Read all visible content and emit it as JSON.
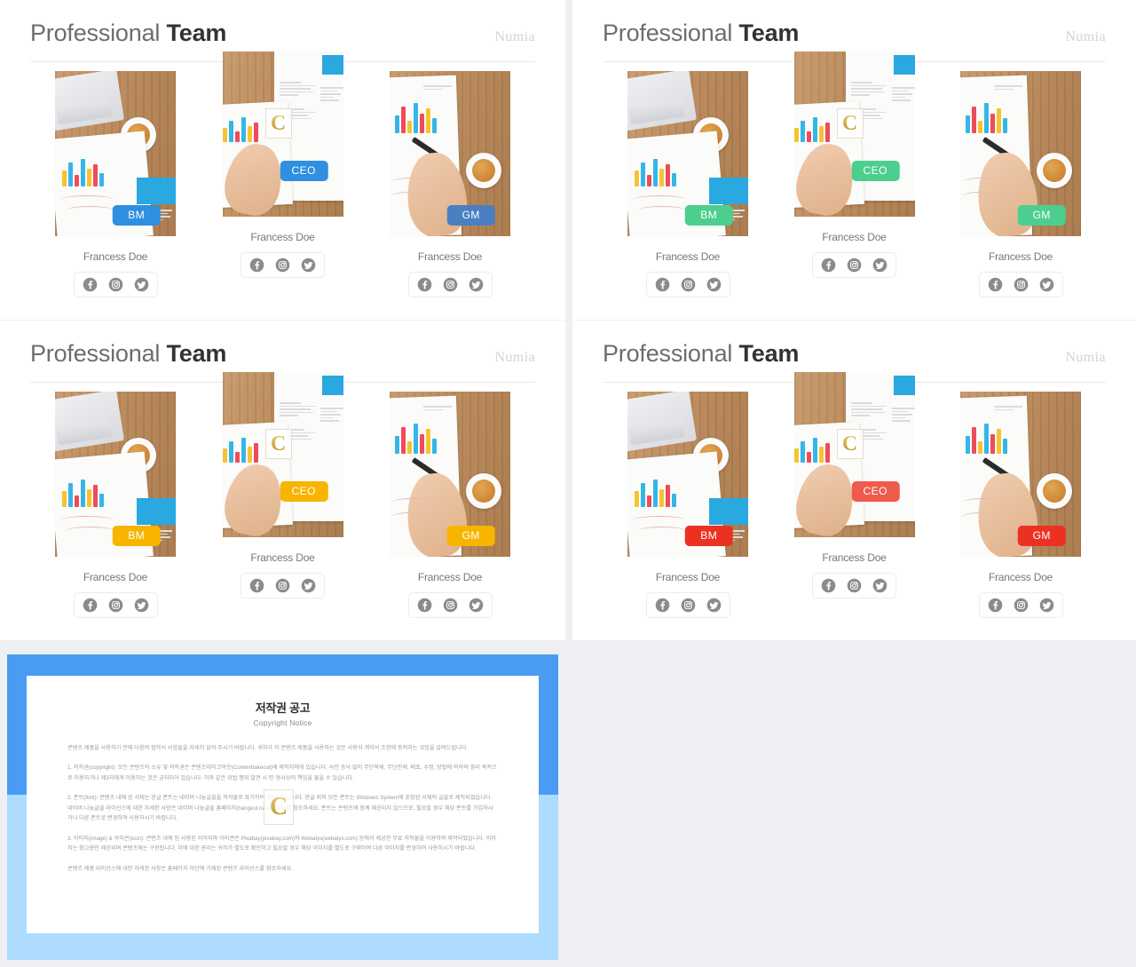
{
  "theme": {
    "page_background": "#eef0f3",
    "panel_background": "#ffffff",
    "title_color": "#333333",
    "brand_color": "#d2d2d2",
    "frame_blue_top": "#4a9cf2",
    "frame_blue_bottom": "#addcff",
    "watermark_gold": "#c9a227"
  },
  "watermark": {
    "letter": "C"
  },
  "panels": [
    {
      "id": "panel-blue",
      "title_light": "Professional",
      "title_bold": "Team",
      "brand": "Numia",
      "accent": "#2f8fe0",
      "cards": [
        {
          "badge": "BM",
          "name": "Francess Doe",
          "photo": "desk-laptop-coffee-chart"
        },
        {
          "badge": "CEO",
          "name": "Francess Doe",
          "photo": "hand-pointing-resume"
        },
        {
          "badge": "GM",
          "name": "Francess Doe",
          "photo": "hand-pen-chart-coffee"
        }
      ]
    },
    {
      "id": "panel-green",
      "title_light": "Professional",
      "title_bold": "Team",
      "brand": "Numia",
      "accent": "#4ccf8e",
      "cards": [
        {
          "badge": "BM",
          "name": "Francess Doe",
          "photo": "desk-laptop-coffee-chart"
        },
        {
          "badge": "CEO",
          "name": "Francess Doe",
          "photo": "hand-pointing-resume"
        },
        {
          "badge": "GM",
          "name": "Francess Doe",
          "photo": "hand-pen-chart-coffee"
        }
      ]
    },
    {
      "id": "panel-amber",
      "title_light": "Professional",
      "title_bold": "Team",
      "brand": "Numia",
      "accent": "#f7b500",
      "cards": [
        {
          "badge": "BM",
          "name": "Francess Doe",
          "photo": "desk-laptop-coffee-chart"
        },
        {
          "badge": "CEO",
          "name": "Francess Doe",
          "photo": "hand-pointing-resume"
        },
        {
          "badge": "GM",
          "name": "Francess Doe",
          "photo": "hand-pen-chart-coffee"
        }
      ]
    },
    {
      "id": "panel-red",
      "title_light": "Professional",
      "title_bold": "Team",
      "brand": "Numia",
      "accent": "#ec3123",
      "cards": [
        {
          "badge": "BM",
          "name": "Francess Doe",
          "photo": "desk-laptop-coffee-chart"
        },
        {
          "badge": "CEO",
          "name": "Francess Doe",
          "photo": "hand-pointing-resume"
        },
        {
          "badge": "GM",
          "name": "Francess Doe",
          "photo": "hand-pen-chart-coffee"
        }
      ]
    }
  ],
  "social_icons": [
    {
      "name": "facebook-icon",
      "glyph": "f"
    },
    {
      "name": "instagram-icon",
      "glyph": "camera"
    },
    {
      "name": "twitter-icon",
      "glyph": "bird"
    }
  ],
  "copyright": {
    "title": "저작권 공고",
    "subtitle": "Copyright Notice",
    "paragraphs": [
      "콘텐츠 제품을 사용하기 전에 다음의 협약서 사항들을 자세히 읽어 주시기 바랍니다. 귀하가 이 콘텐츠 제품을 사용하는 것은 사용자 계약서 조항에 동의하는 것임을 알려드립니다.",
      "1. 저작권(copyright): 모든 콘텐츠의 소유 및 저작권은 콘텐츠테이크아웃(Contenttakeout)에 제작자에게 있습니다. 사전 승낙 없이 무단복제, 무단전재, 배포, 수정, 방법에 의하여 영리 목적으로 이용하거나 제3자에게 이용하는 것은 금지되어 있습니다. 이와 같은 위법 행위 발견 시 민·형사상의 책임을 물을 수 있습니다.",
      "2. 폰트(font): 콘텐츠 내에 된 서체는 한글 폰트는 네이버 나눔글꼴을 저작물로 표기하여 제작되었습니다. 한글 외의 모든 폰트는 Windows System에 포함된 서체의 글꼴로 제작되었습니다. 네이버 나눔글꼴 라이선스에 대한 자세한 사항은 네이버 나눔글꼴 홈페이지(hangeul.naver.com)를 참조하세요. 폰트는 콘텐츠에 함께 제공되지 않으므로, 필요할 경우 해당 폰트를 가입하시거나 다른 폰트로 변경하여 사용하시기 바랍니다.",
      "3. 이미지(image) & 아이콘(icon): 콘텐츠 내에 된 사용된 이미지와 아이콘은 Pixabay(pixabay.com)와 Webalys(webalys.com) 등에서 제공한 무료 저작물을 이용하여 제작되었습니다. 이미지는 참고용만 제공되며 콘텐츠에는 구현됩니다. 이에 대한 권리는 귀하가 별도로 확인하고 필요할 경우 해당 이미지를 별도로 구매하여 다른 이미지를 변경하여 사용하시기 바랍니다.",
      "콘텐츠 제품 라이선스에 대한 자세한 사항은 홈페이지 하단에 기재된 콘텐츠 라이선스를 참조하세요."
    ]
  }
}
